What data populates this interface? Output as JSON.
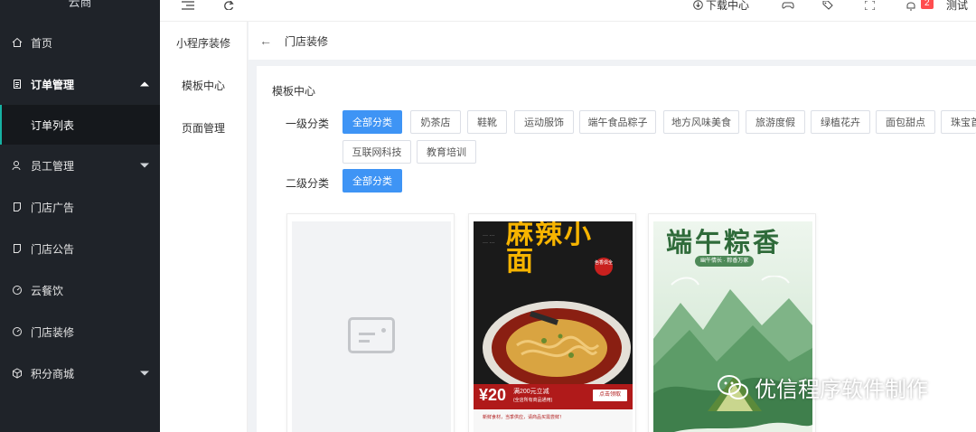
{
  "sidebar": {
    "brand": "云商",
    "items": [
      {
        "label": "首页",
        "icon": "home-icon"
      },
      {
        "label": "订单管理",
        "icon": "document-icon",
        "open": true,
        "children": [
          {
            "label": "订单列表"
          }
        ]
      },
      {
        "label": "员工管理",
        "icon": "user-icon"
      },
      {
        "label": "门店广告",
        "icon": "page-icon"
      },
      {
        "label": "门店公告",
        "icon": "page-icon"
      },
      {
        "label": "云餐饮",
        "icon": "gauge-icon"
      },
      {
        "label": "门店装修",
        "icon": "gauge-icon"
      },
      {
        "label": "积分商城",
        "icon": "cube-icon"
      }
    ]
  },
  "topbar": {
    "download_label": "下载中心",
    "notification_count": "2",
    "user_label": "测试"
  },
  "subside": {
    "items": [
      {
        "label": "小程序装修"
      },
      {
        "label": "模板中心"
      },
      {
        "label": "页面管理"
      }
    ]
  },
  "pagehead": {
    "title": "门店装修"
  },
  "main": {
    "card_title": "模板中心",
    "level1_label": "一级分类",
    "level2_label": "二级分类",
    "level1_tags": [
      "全部分类",
      "奶茶店",
      "鞋靴",
      "运动服饰",
      "端午食品粽子",
      "地方风味美食",
      "旅游度假",
      "绿植花卉",
      "面包甜点",
      "珠宝首",
      "互联网科技",
      "教育培训"
    ],
    "level2_tags": [
      "全部分类"
    ]
  },
  "templates": {
    "noodle": {
      "title": "麻辣小面",
      "stamp": "色香俱全",
      "price": "¥20",
      "offer": "满200元立减",
      "offer_note": "(全店所有商品通用)",
      "button": "点击领取",
      "notice": "新鲜食材，当季供应，请商品买需尝鲜！"
    },
    "dragon": {
      "title": "端午粽香",
      "subtitle": "幽午情长 · 粽香万家"
    }
  },
  "watermark": "优信程序软件制作",
  "colors": {
    "sidebar_bg": "#1f2329",
    "accent": "#3e94f5",
    "badge": "#ff4d4f"
  }
}
